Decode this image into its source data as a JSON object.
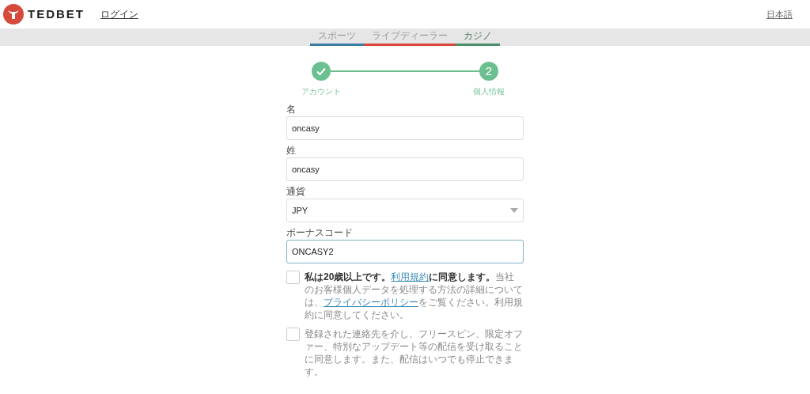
{
  "header": {
    "brand": "TEDBET",
    "login": "ログイン",
    "language": "日本語"
  },
  "tabs": [
    {
      "label": "スポーツ",
      "selected": false,
      "color": "#3a7ca5"
    },
    {
      "label": "ライブディーラー",
      "selected": false,
      "color": "#d9473a"
    },
    {
      "label": "カジノ",
      "selected": true,
      "color": "#4a8f6a"
    }
  ],
  "steps": [
    {
      "kind": "done",
      "label": "アカウント"
    },
    {
      "kind": "current",
      "number": "2",
      "label": "個人情報"
    }
  ],
  "fields": [
    {
      "kind": "text",
      "label": "名",
      "value": "oncasy",
      "focused": false
    },
    {
      "kind": "text",
      "label": "姓",
      "value": "oncasy",
      "focused": false
    },
    {
      "kind": "select",
      "label": "通貨",
      "value": "JPY",
      "focused": false
    },
    {
      "kind": "text",
      "label": "ボーナスコード",
      "value": "ONCASY2",
      "focused": true
    }
  ],
  "consents": [
    {
      "checked": false,
      "segments": [
        {
          "kind": "bold",
          "text": "私は20歳以上です。"
        },
        {
          "kind": "link",
          "text": "利用規約"
        },
        {
          "kind": "bold",
          "text": "に同意します。"
        },
        {
          "kind": "plain",
          "text": "当社のお客様個人データを処理する方法の詳細については、"
        },
        {
          "kind": "link",
          "text": "プライバシーポリシー"
        },
        {
          "kind": "plain",
          "text": "をご覧ください。利用規約に同意してください。"
        }
      ]
    },
    {
      "checked": false,
      "segments": [
        {
          "kind": "plain",
          "text": "登録された連絡先を介し、フリースピン、限定オファー、特別なアップデート等の配信を受け取ることに同意します。また、配信はいつでも停止できます。"
        }
      ]
    }
  ]
}
